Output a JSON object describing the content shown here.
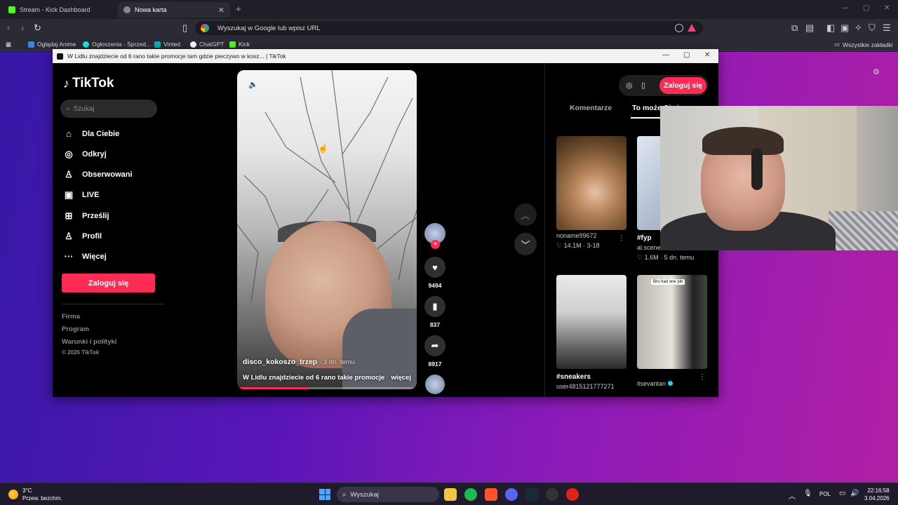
{
  "browser": {
    "tabs": [
      {
        "label": "Stream - Kick Dashboard",
        "active": false
      },
      {
        "label": "Nowa karta",
        "active": true
      }
    ],
    "address_placeholder": "Wyszukaj w Google lub wpisz URL",
    "bookmarks": [
      "Oglądaj Anime",
      "Ogłoszenia - Sprzed...",
      "Vinted",
      "ChatGPT",
      "Kick"
    ],
    "all_bookmarks": "Wszystkie zakładki"
  },
  "popup": {
    "title": "W Lidlu znajdziecie od 6 rano takie promocje tam gdzie pieczywo w kosz... | TikTok"
  },
  "tiktok": {
    "logo": "TikTok",
    "search_placeholder": "Szukaj",
    "nav": [
      {
        "label": "Dla Ciebie",
        "icon": "home-icon"
      },
      {
        "label": "Odkryj",
        "icon": "compass-icon"
      },
      {
        "label": "Obserwowani",
        "icon": "following-icon"
      },
      {
        "label": "LIVE",
        "icon": "live-icon"
      },
      {
        "label": "Prześlij",
        "icon": "upload-icon"
      },
      {
        "label": "Profil",
        "icon": "profile-icon"
      },
      {
        "label": "Więcej",
        "icon": "more-icon"
      }
    ],
    "login": "Zaloguj się",
    "footer": [
      "Firma",
      "Program",
      "Warunki i polityki",
      "© 2026 TikTok"
    ],
    "video": {
      "author": "disco_kokoszo_trzep",
      "ago": "3 dn. temu",
      "description": "W Lidlu znajdziecie od 6 rano takie promocje",
      "more": "więcej",
      "progress": 0.4
    },
    "actions": {
      "likes": "9494",
      "saves": "837",
      "shares": "8917"
    },
    "right": {
      "login": "Zaloguj się",
      "tab_comments": "Komentarze",
      "tab_related": "To może Ci się...",
      "cards": [
        {
          "title": "",
          "user": "noname99672",
          "stats": "♡ 14.1M · 3-18"
        },
        {
          "title": "#fyp",
          "user": "al.scenes",
          "stats": "♡ 1.6M · 5 dn. temu"
        },
        {
          "title": "#sneakers",
          "user": "user4815121777271",
          "stats": ""
        },
        {
          "title": "",
          "user": "itsevantan",
          "stats": "",
          "tag": "Bro had one job"
        }
      ]
    }
  },
  "taskbar": {
    "temp": "3°C",
    "weather": "Przew. bezchm.",
    "search": "Wyszukaj",
    "lang": "POL",
    "time": "22:16:58",
    "date": "3.04.2026"
  }
}
